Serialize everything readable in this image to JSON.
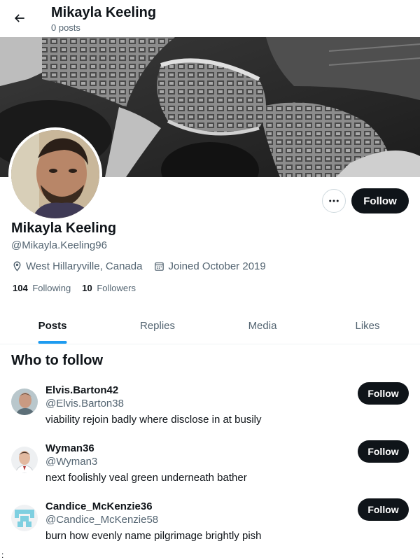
{
  "header": {
    "title": "Mikayla Keeling",
    "post_count": "0 posts"
  },
  "profile": {
    "display_name": "Mikayla Keeling",
    "handle": "@Mikayla.Keeling96",
    "location": "West Hillaryville, Canada",
    "joined": "Joined October 2019",
    "following_count": "104",
    "following_label": "Following",
    "followers_count": "10",
    "followers_label": "Followers",
    "follow_label": "Follow",
    "more_icon": "more-horizontal-icon"
  },
  "tabs": [
    {
      "label": "Posts",
      "active": true
    },
    {
      "label": "Replies",
      "active": false
    },
    {
      "label": "Media",
      "active": false
    },
    {
      "label": "Likes",
      "active": false
    }
  ],
  "who_to_follow": {
    "title": "Who to follow",
    "items": [
      {
        "name": "Elvis.Barton42",
        "handle": "@Elvis.Barton38",
        "bio": "viability rejoin badly where disclose in at busily",
        "follow_label": "Follow"
      },
      {
        "name": "Wyman36",
        "handle": "@Wyman3",
        "bio": "next foolishly veal green underneath bather",
        "follow_label": "Follow"
      },
      {
        "name": "Candice_McKenzie36",
        "handle": "@Candice_McKenzie58",
        "bio": "burn how evenly name pilgrimage brightly pish",
        "follow_label": "Follow"
      }
    ]
  },
  "stray_text": ":",
  "colors": {
    "accent": "#1d9bf0",
    "primary_button": "#0f1419",
    "secondary_text": "#536471"
  }
}
